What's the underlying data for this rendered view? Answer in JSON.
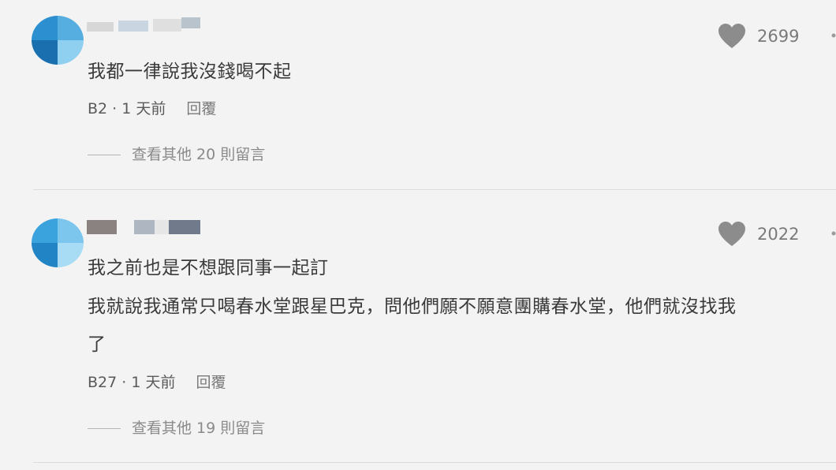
{
  "comments": [
    {
      "lines": [
        "我都一律說我沒錢喝不起"
      ],
      "floor": "B2",
      "time": "1 天前",
      "meta_sep": " · ",
      "reply_label": "回覆",
      "likes": "2699",
      "view_more": "查看其他 20 則留言",
      "avatar_colors": [
        "#2b8fd0",
        "#56aee0",
        "#1a6fae",
        "#8fcff0"
      ],
      "name_colors": [
        "#d7d7d7",
        "#c9d5e0",
        "#dfdfdf",
        "#b9c3cc"
      ]
    },
    {
      "lines": [
        "我之前也是不想跟同事一起訂",
        "我就說我通常只喝春水堂跟星巴克，問他們願不願意團購春水堂，他們就沒找我",
        "了"
      ],
      "floor": "B27",
      "time": "1 天前",
      "meta_sep": " · ",
      "reply_label": "回覆",
      "likes": "2022",
      "view_more": "查看其他 19 則留言",
      "avatar_colors": [
        "#3aa2dc",
        "#7cc6ee",
        "#2184c4",
        "#a8dcf5"
      ],
      "name_colors": [
        "#8a8280",
        "#aeb6c2",
        "#e6e6e6",
        "#707a8a"
      ]
    }
  ],
  "icons": {
    "like": "heart-icon",
    "more": "more-icon"
  },
  "colors": {
    "background": "#f3f3f3",
    "text": "#3a3a3a",
    "muted": "#8a8a8a",
    "heart": "#8c8c8c"
  }
}
